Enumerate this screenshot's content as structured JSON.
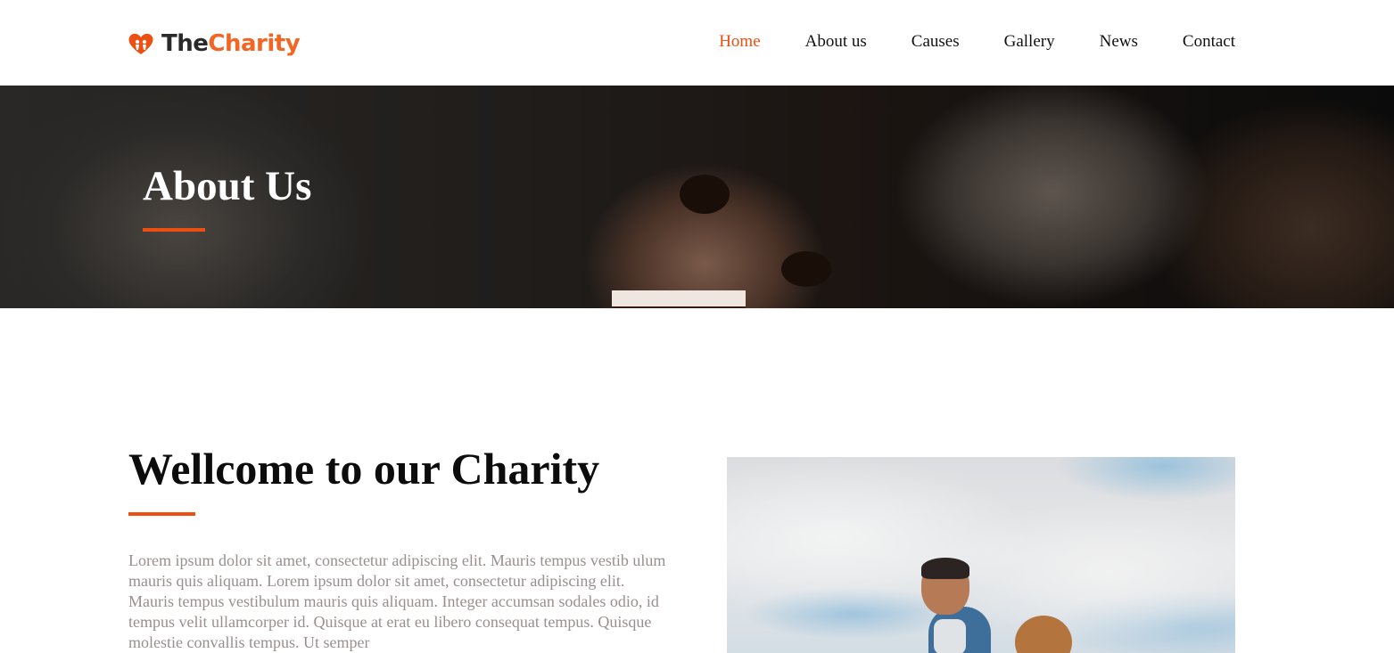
{
  "brand": {
    "name_dark": "The",
    "name_accent": "Charity",
    "logo_icon": "heart-hands-icon",
    "accent_color": "#ee4e10"
  },
  "nav": {
    "items": [
      {
        "label": "Home",
        "active": true
      },
      {
        "label": "About us",
        "active": false
      },
      {
        "label": "Causes",
        "active": false
      },
      {
        "label": "Gallery",
        "active": false
      },
      {
        "label": "News",
        "active": false
      },
      {
        "label": "Contact",
        "active": false
      }
    ]
  },
  "hero": {
    "title": "About Us"
  },
  "welcome": {
    "title": "Wellcome to our Charity",
    "body": "Lorem ipsum dolor sit amet, consectetur adipiscing elit. Mauris tempus vestib ulum mauris quis aliquam. Lorem ipsum dolor sit amet, consectetur adipiscing elit. Mauris tempus vestibulum mauris quis aliquam. Integer accumsan sodales odio, id tempus velit ullamcorper id. Quisque at erat eu libero consequat tempus. Quisque molestie convallis tempus. Ut semper"
  }
}
